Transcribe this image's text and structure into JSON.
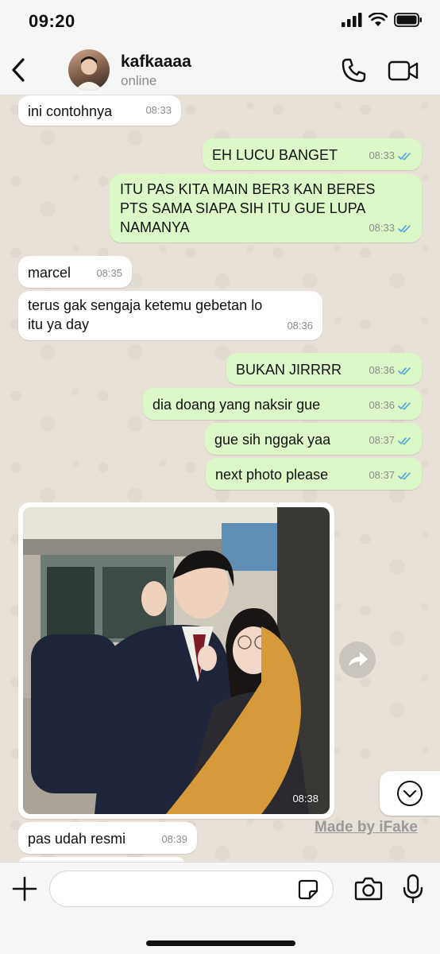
{
  "status_bar": {
    "time": "09:20"
  },
  "header": {
    "contact_name": "kafkaaaa",
    "contact_status": "online",
    "icons": [
      "back-chevron-icon",
      "phone-icon",
      "video-camera-icon"
    ]
  },
  "messages": [
    {
      "direction": "in",
      "text": "ini contohnya",
      "time": "08:33"
    },
    {
      "direction": "out",
      "text": "EH LUCU BANGET",
      "time": "08:33",
      "read": true
    },
    {
      "direction": "out",
      "lines": [
        "ITU PAS KITA MAIN BER3 KAN BERES",
        "PTS SAMA SIAPA SIH ITU GUE LUPA",
        "NAMANYA"
      ],
      "time": "08:33",
      "read": true
    },
    {
      "direction": "in",
      "text": "marcel",
      "time": "08:35"
    },
    {
      "direction": "in",
      "lines": [
        "terus gak sengaja ketemu gebetan lo",
        "itu ya day"
      ],
      "time": "08:36"
    },
    {
      "direction": "out",
      "text": "BUKAN JIRRRR",
      "time": "08:36",
      "read": true
    },
    {
      "direction": "out",
      "text": "dia doang yang naksir gue",
      "time": "08:36",
      "read": true
    },
    {
      "direction": "out",
      "text": "gue sih nggak yaa",
      "time": "08:37",
      "read": true
    },
    {
      "direction": "out",
      "text": "next photo please",
      "time": "08:37",
      "read": true
    },
    {
      "direction": "in",
      "type": "photo",
      "time": "08:38"
    },
    {
      "direction": "in",
      "text": "pas udah resmi",
      "time": "08:39"
    }
  ],
  "watermark": "Made by iFake",
  "composer": {
    "placeholder": ""
  },
  "colors": {
    "outgoing_bubble": "#dcf8c6",
    "incoming_bubble": "#ffffff",
    "read_ticks": "#4fa3e0",
    "wallpaper": "#e8e1d8"
  }
}
